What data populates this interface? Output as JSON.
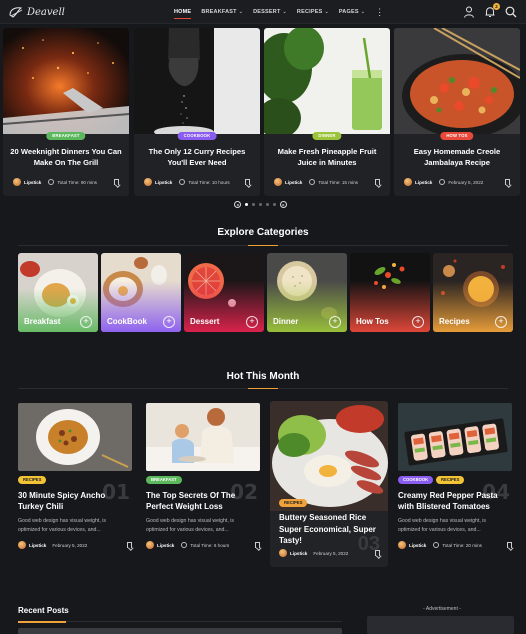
{
  "brand": {
    "logo_text": "Deavell"
  },
  "nav": {
    "items": [
      {
        "label": "HOME",
        "dropdown": false,
        "active": true
      },
      {
        "label": "BREAKFAST",
        "dropdown": true
      },
      {
        "label": "DESSERT",
        "dropdown": true
      },
      {
        "label": "RECIPES",
        "dropdown": true
      },
      {
        "label": "PAGES",
        "dropdown": true
      }
    ],
    "more_icon": "kebab-menu-icon",
    "icons": [
      "user-icon",
      "bell-icon",
      "search-icon"
    ],
    "notification_count": "2"
  },
  "hero": {
    "slides": [
      {
        "category": "BREAKFAST",
        "category_color": "#5cb85c",
        "title": "20 Weeknight Dinners You Can Make On The Grill",
        "author": "Lipstick",
        "meta": "Total Time: 90 mins"
      },
      {
        "category": "COOKBOOK",
        "category_color": "#8a5cf0",
        "title": "The Only 12 Curry Recipes You'll Ever Need",
        "author": "Lipstick",
        "meta": "Total Time: 10 hours"
      },
      {
        "category": "DINNER",
        "category_color": "#9cc43a",
        "title": "Make Fresh Pineapple Fruit Juice in Minutes",
        "author": "Lipstick",
        "meta": "Total Time: 15 mins"
      },
      {
        "category": "HOW TOS",
        "category_color": "#e8493b",
        "title": "Easy Homemade Creole Jambalaya Recipe",
        "author": "Lipstick",
        "meta": "February 5, 2022"
      }
    ],
    "pager_dots": 5,
    "active_dot": 0
  },
  "categories": {
    "heading": "Explore Categories",
    "items": [
      {
        "label": "Breakfast",
        "tint": "#5cb85c"
      },
      {
        "label": "CookBook",
        "tint": "#8a5cf0"
      },
      {
        "label": "Dessert",
        "tint": "#e3244e"
      },
      {
        "label": "Dinner",
        "tint": "#9cc43a"
      },
      {
        "label": "How Tos",
        "tint": "#e8493b"
      },
      {
        "label": "Recipes",
        "tint": "#f0a23a"
      }
    ]
  },
  "hot": {
    "heading": "Hot This Month",
    "posts": [
      {
        "number": "01",
        "category": "RECIPES",
        "category_color": "#f2c335",
        "title": "30 Minute Spicy Ancho Turkey Chili",
        "excerpt": "Good web design has visual weight, is optimized for various devices, and...",
        "author": "Lipstick",
        "meta": "February 5, 2022"
      },
      {
        "number": "02",
        "category": "BREAKFAST",
        "category_color": "#5cb85c",
        "title": "The Top Secrets Of The Perfect Weight Loss",
        "excerpt": "Good web design has visual weight, is optimized for various devices, and...",
        "author": "Lipstick",
        "meta": "Total Time: 6 hours"
      },
      {
        "number": "03",
        "category": "RECIPES",
        "category_color": "#f0a23a",
        "title": "Buttery Seasoned Rice Super Economical, Super Tasty!",
        "excerpt": "",
        "author": "Lipstick",
        "meta": "February 5, 2022"
      },
      {
        "number": "04",
        "category": "COOKBOOK",
        "category_color": "#8a5cf0",
        "category2": "RECIPES",
        "category2_color": "#f2c335",
        "title": "Creamy Red Pepper Pasta with Blistered Tomatoes",
        "excerpt": "Good web design has visual weight, is optimized for various devices, and...",
        "author": "Lipstick",
        "meta": "Total Time: 20 mins"
      }
    ]
  },
  "recent": {
    "heading": "Recent Posts"
  },
  "advertisement": {
    "label": "- Advertisement -"
  }
}
